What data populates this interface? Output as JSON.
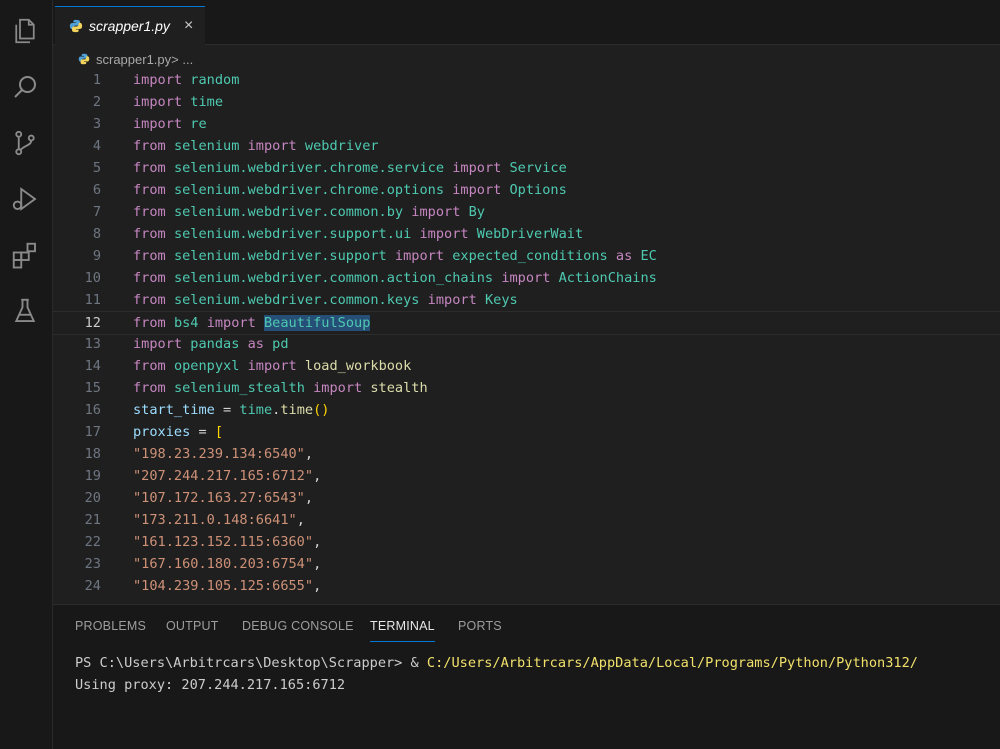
{
  "tab": {
    "label": "scrapper1.py",
    "close": "×"
  },
  "breadcrumb": {
    "file": "scrapper1.py",
    "sep": " > ...",
    "full": "scrapper1.py > ..."
  },
  "editor": {
    "lines": [
      {
        "n": "1"
      },
      {
        "n": "2"
      },
      {
        "n": "3"
      },
      {
        "n": "4"
      },
      {
        "n": "5"
      },
      {
        "n": "6"
      },
      {
        "n": "7"
      },
      {
        "n": "8"
      },
      {
        "n": "9"
      },
      {
        "n": "10"
      },
      {
        "n": "11"
      },
      {
        "n": "12"
      },
      {
        "n": "13"
      },
      {
        "n": "14"
      },
      {
        "n": "15"
      },
      {
        "n": "16"
      },
      {
        "n": "17"
      },
      {
        "n": "18"
      },
      {
        "n": "19"
      },
      {
        "n": "20"
      },
      {
        "n": "21"
      },
      {
        "n": "22"
      },
      {
        "n": "23"
      },
      {
        "n": "24"
      }
    ],
    "code": {
      "l1": [
        "import",
        "random"
      ],
      "l2": [
        "import",
        "time"
      ],
      "l3": [
        "import",
        "re"
      ],
      "l4": [
        "from",
        "selenium",
        "import",
        "webdriver"
      ],
      "l5": [
        "from",
        "selenium.webdriver.chrome.service",
        "import",
        "Service"
      ],
      "l6": [
        "from",
        "selenium.webdriver.chrome.options",
        "import",
        "Options"
      ],
      "l7": [
        "from",
        "selenium.webdriver.common.by",
        "import",
        "By"
      ],
      "l8": [
        "from",
        "selenium.webdriver.support.ui",
        "import",
        "WebDriverWait"
      ],
      "l9": [
        "from",
        "selenium.webdriver.support",
        "import",
        "expected_conditions",
        "as",
        "EC"
      ],
      "l10": [
        "from",
        "selenium.webdriver.common.action_chains",
        "import",
        "ActionChains"
      ],
      "l11": [
        "from",
        "selenium.webdriver.common.keys",
        "import",
        "Keys"
      ],
      "l12": [
        "from",
        "bs4",
        "import",
        "BeautifulSoup"
      ],
      "l13": [
        "import",
        "pandas",
        "as",
        "pd"
      ],
      "l14": [
        "from",
        "openpyxl",
        "import",
        "load_workbook"
      ],
      "l15": [
        "from",
        "selenium_stealth",
        "import",
        "stealth"
      ],
      "l16": [
        "start_time",
        "=",
        "time",
        ".",
        "time",
        "()"
      ],
      "l17": [
        "proxies",
        "=",
        "["
      ],
      "l18": [
        "\"198.23.239.134:6540\"",
        ","
      ],
      "l19": [
        "\"207.244.217.165:6712\"",
        ","
      ],
      "l20": [
        "\"107.172.163.27:6543\"",
        ","
      ],
      "l21": [
        "\"173.211.0.148:6641\"",
        ","
      ],
      "l22": [
        "\"161.123.152.115:6360\"",
        ","
      ],
      "l23": [
        "\"167.160.180.203:6754\"",
        ","
      ],
      "l24": [
        "\"104.239.105.125:6655\"",
        ","
      ]
    }
  },
  "panel": {
    "tabs": [
      "PROBLEMS",
      "OUTPUT",
      "DEBUG CONSOLE",
      "TERMINAL",
      "PORTS"
    ],
    "active_tab": "TERMINAL"
  },
  "terminal": {
    "prompt": "PS C:\\Users\\Arbitrcars\\Desktop\\Scrapper> & ",
    "command_path": "C:/Users/Arbitrcars/AppData/Local/Programs/Python/Python312/",
    "output": "Using proxy: 207.244.217.165:6712"
  },
  "activity_bar": {
    "icons": [
      "explorer-icon",
      "search-icon",
      "source-control-icon",
      "run-debug-icon",
      "extensions-icon",
      "testing-icon"
    ]
  },
  "colors": {
    "keyword": "#c586c0",
    "module": "#4ec9b0",
    "variable": "#9cdcfe",
    "function": "#dcdcaa",
    "string": "#ce9178",
    "bracket": "#ffd700",
    "terminal_path": "#f0e06a",
    "accent": "#0078d4"
  }
}
